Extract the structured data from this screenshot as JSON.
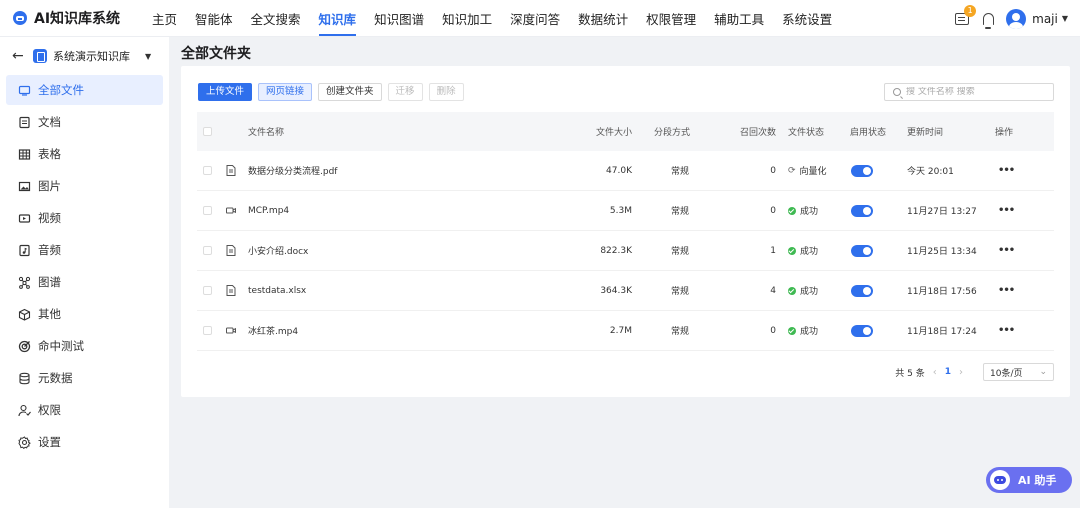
{
  "app": {
    "title": "AI知识库系统"
  },
  "nav": {
    "items": [
      {
        "label": "主页"
      },
      {
        "label": "智能体"
      },
      {
        "label": "全文搜索"
      },
      {
        "label": "知识库",
        "active": true
      },
      {
        "label": "知识图谱"
      },
      {
        "label": "知识加工"
      },
      {
        "label": "深度问答"
      },
      {
        "label": "数据统计"
      },
      {
        "label": "权限管理"
      },
      {
        "label": "辅助工具"
      },
      {
        "label": "系统设置"
      }
    ]
  },
  "header": {
    "message_badge": "1",
    "username": "maji"
  },
  "sidebar": {
    "kb_name": "系统演示知识库",
    "items": [
      {
        "label": "全部文件",
        "icon": "folder-icon",
        "active": true
      },
      {
        "label": "文档",
        "icon": "document-icon"
      },
      {
        "label": "表格",
        "icon": "table-icon"
      },
      {
        "label": "图片",
        "icon": "image-icon"
      },
      {
        "label": "视频",
        "icon": "video-icon"
      },
      {
        "label": "音频",
        "icon": "audio-icon"
      },
      {
        "label": "图谱",
        "icon": "graph-icon"
      },
      {
        "label": "其他",
        "icon": "cube-icon"
      },
      {
        "label": "命中测试",
        "icon": "target-icon"
      },
      {
        "label": "元数据",
        "icon": "database-icon"
      },
      {
        "label": "权限",
        "icon": "user-permission-icon"
      },
      {
        "label": "设置",
        "icon": "gear-icon"
      }
    ]
  },
  "main": {
    "title": "全部文件夹",
    "toolbar": {
      "upload": "上传文件",
      "web_link": "网页链接",
      "create_folder": "创建文件夹",
      "move": "迁移",
      "delete": "删除"
    },
    "search": {
      "placeholder": "搜 文件名称 搜索"
    }
  },
  "table": {
    "columns": {
      "name": "文件名称",
      "size": "文件大小",
      "split": "分段方式",
      "recall": "召回次数",
      "status": "文件状态",
      "enabled": "启用状态",
      "updated": "更新时间",
      "actions": "操作"
    },
    "rows": [
      {
        "icon": "document-icon",
        "name": "数据分级分类流程.pdf",
        "size": "47.0K",
        "split": "常规",
        "recall": "0",
        "status": "向量化",
        "status_type": "vectorizing",
        "enabled": true,
        "updated": "今天 20:01"
      },
      {
        "icon": "video-icon",
        "name": "MCP.mp4",
        "size": "5.3M",
        "split": "常规",
        "recall": "0",
        "status": "成功",
        "status_type": "success",
        "enabled": true,
        "updated": "11月27日 13:27"
      },
      {
        "icon": "document-icon",
        "name": "小安介绍.docx",
        "size": "822.3K",
        "split": "常规",
        "recall": "1",
        "status": "成功",
        "status_type": "success",
        "enabled": true,
        "updated": "11月25日 13:34"
      },
      {
        "icon": "document-icon",
        "name": "testdata.xlsx",
        "size": "364.3K",
        "split": "常规",
        "recall": "4",
        "status": "成功",
        "status_type": "success",
        "enabled": true,
        "updated": "11月18日 17:56"
      },
      {
        "icon": "video-icon",
        "name": "冰红茶.mp4",
        "size": "2.7M",
        "split": "常规",
        "recall": "0",
        "status": "成功",
        "status_type": "success",
        "enabled": true,
        "updated": "11月18日 17:24"
      }
    ],
    "more_label": "•••"
  },
  "pagination": {
    "total": "共 5 条",
    "current": "1",
    "page_size": "10条/页"
  },
  "assistant": {
    "label": "AI 助手"
  },
  "colors": {
    "accent": "#2f6fec",
    "success": "#3fba52",
    "badge": "#f5a623",
    "assistant": "#6a70f0"
  }
}
